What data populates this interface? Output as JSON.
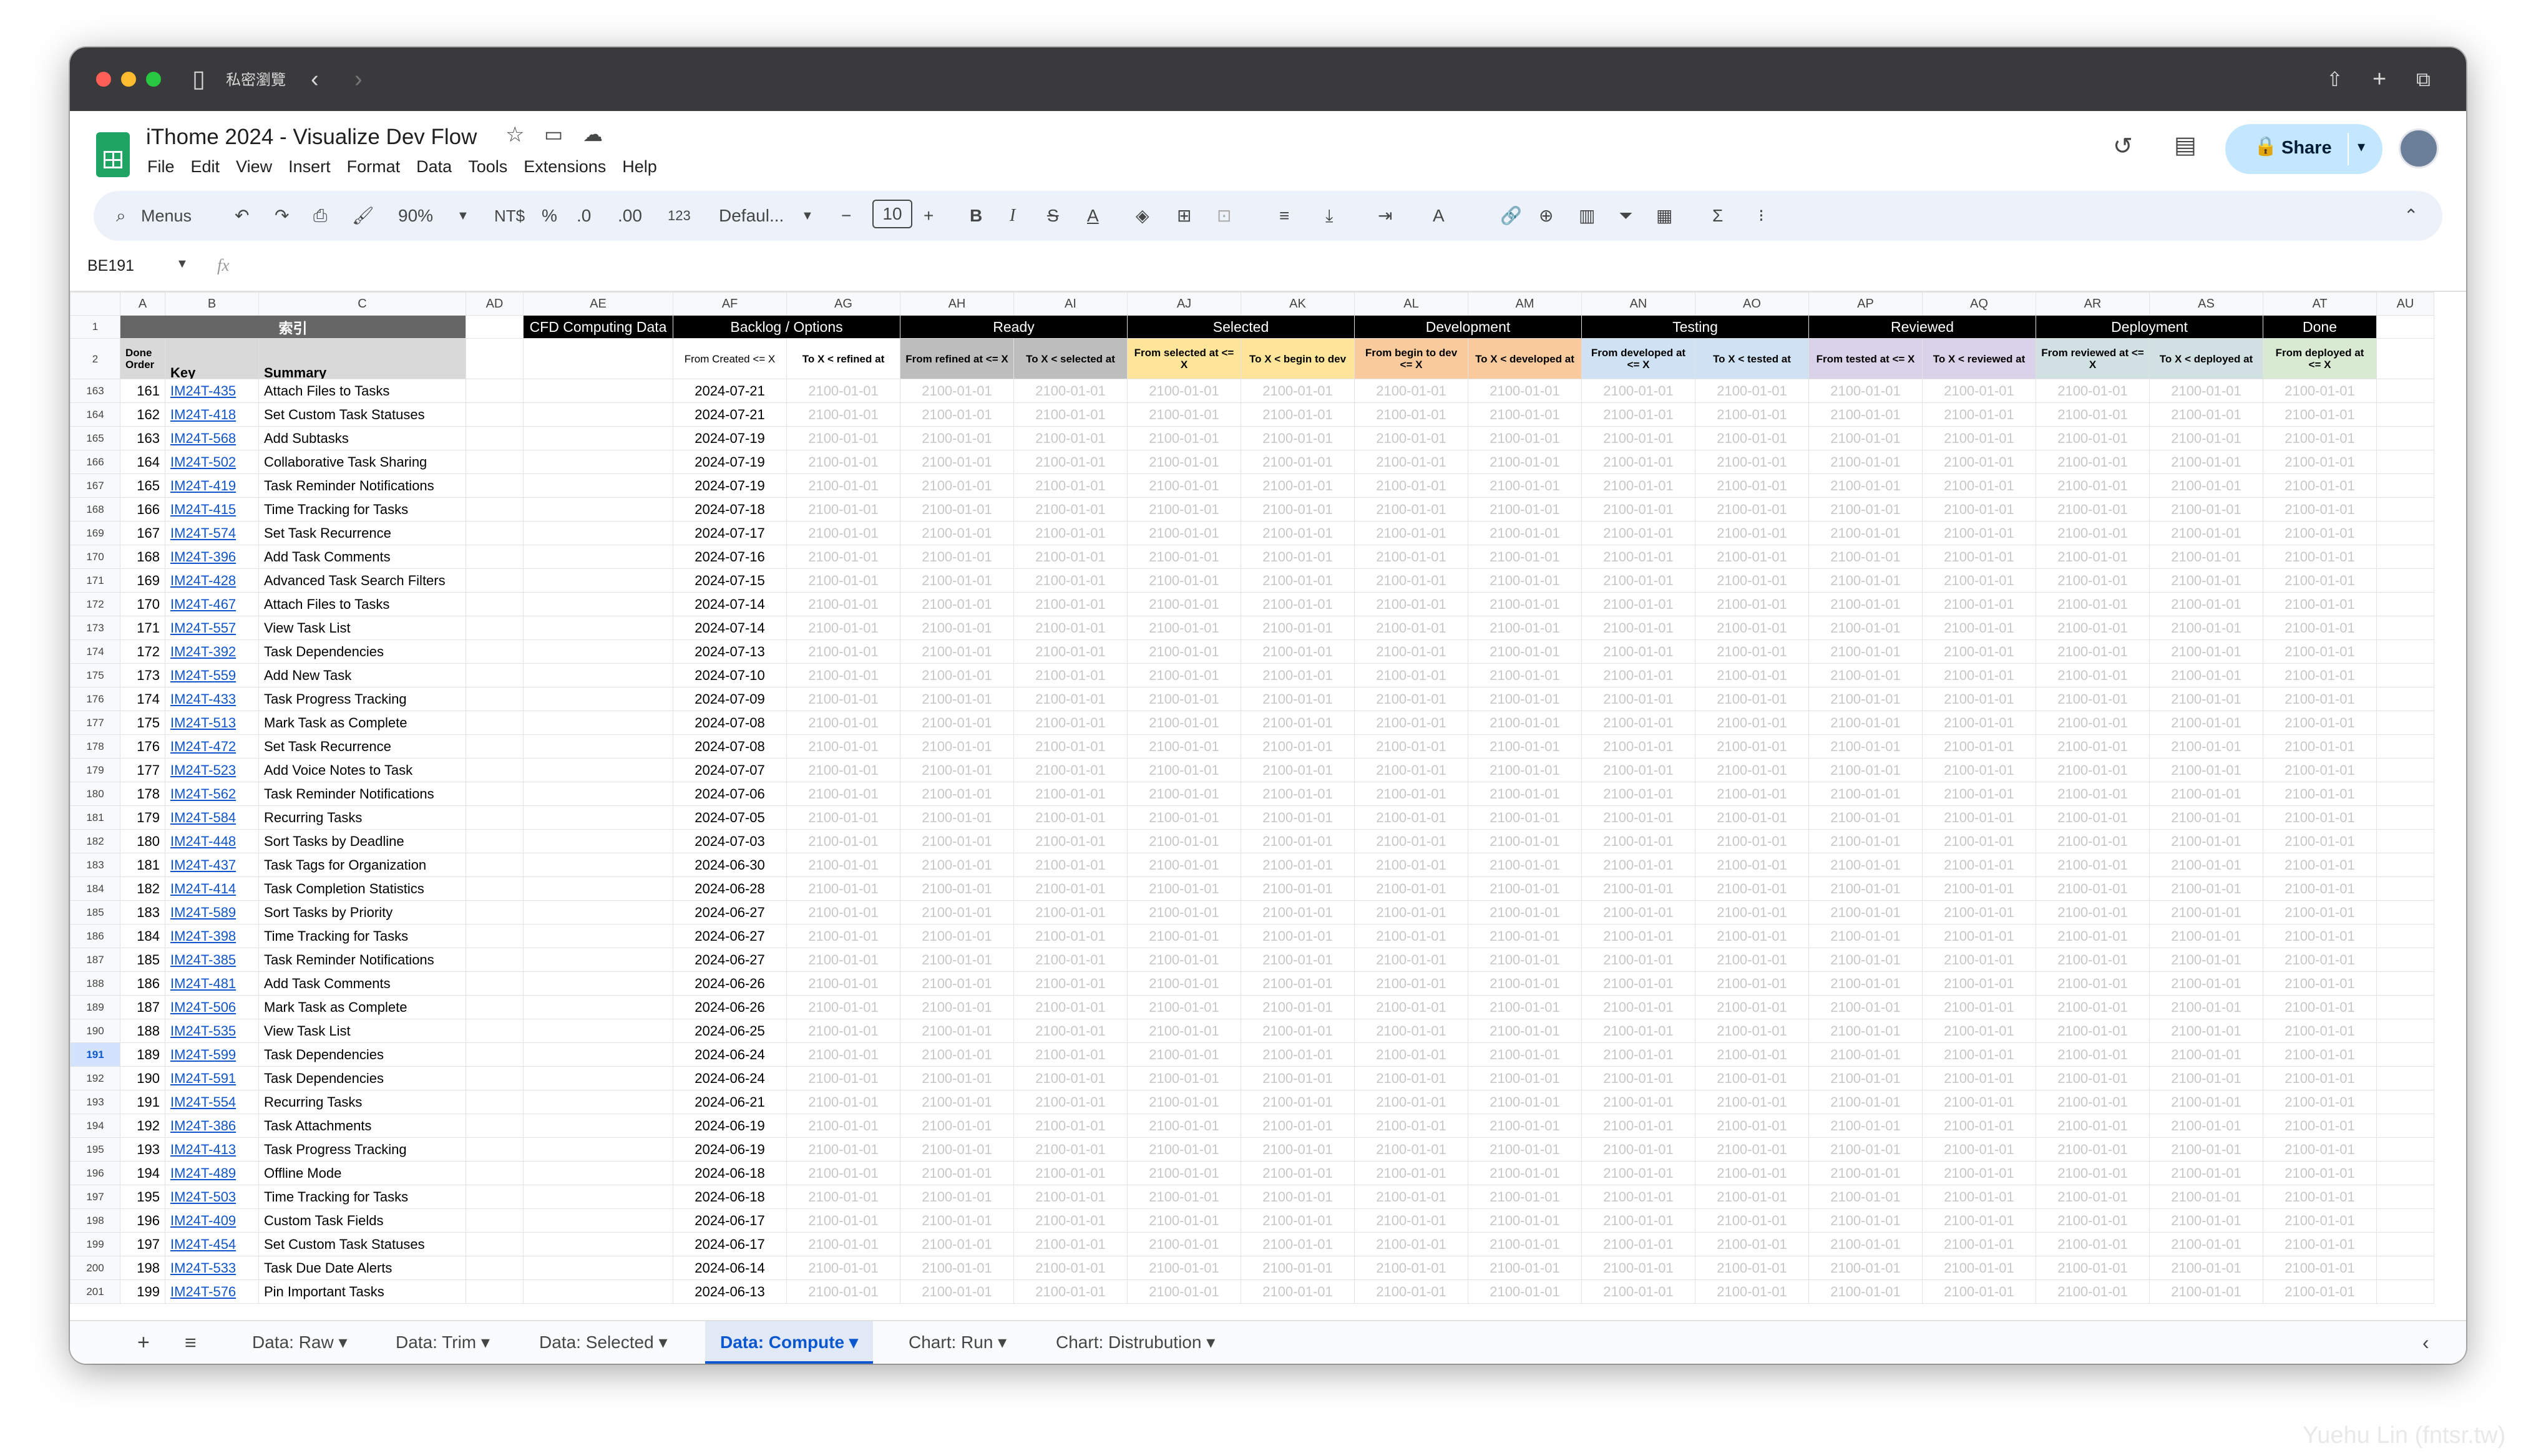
{
  "browser": {
    "private_label": "私密瀏覽",
    "back_icon": "chevron-left-icon",
    "forward_icon": "chevron-right-icon"
  },
  "doc": {
    "title": "iThome 2024 - Visualize Dev Flow"
  },
  "menu": [
    "File",
    "Edit",
    "View",
    "Insert",
    "Format",
    "Data",
    "Tools",
    "Extensions",
    "Help"
  ],
  "share_label": "Share",
  "toolbar": {
    "search": "Menus",
    "zoom": "90%",
    "currency": "NT$",
    "percent": "%",
    "dec_dec": ".0",
    "inc_dec": ".00",
    "num_fmt": "123",
    "font": "Defaul...",
    "font_size": "10"
  },
  "namebox": "BE191",
  "fx": "fx",
  "columns": [
    "A",
    "B",
    "C",
    "AD",
    "AE",
    "AF",
    "AG",
    "AH",
    "AI",
    "AJ",
    "AK",
    "AL",
    "AM",
    "AN",
    "AO",
    "AP",
    "AQ",
    "AR",
    "AS",
    "AT",
    "AU"
  ],
  "header1": {
    "index": "索引",
    "cfd": "CFD Computing Data",
    "backlog": "Backlog / Options",
    "ready": "Ready",
    "selected": "Selected",
    "development": "Development",
    "testing": "Testing",
    "reviewed": "Reviewed",
    "deployment": "Deployment",
    "done": "Done"
  },
  "header2": {
    "done_order": "Done Order",
    "key": "Key",
    "summary": "Summary",
    "af": "From Created <= X",
    "ag": "To X < refined at",
    "ah": "From refined at <= X",
    "ai": "To X < selected at",
    "aj": "From selected at <= X",
    "ak": "To X < begin to dev",
    "al": "From begin to dev <= X",
    "am": "To X < developed at",
    "an": "From developed at <= X",
    "ao": "To X < tested at",
    "ap": "From tested at <= X",
    "aq": "To X < reviewed at",
    "ar": "From reviewed at <= X",
    "as": "To X < deployed at",
    "at": "From deployed at <= X"
  },
  "colors": {
    "ready": "#bdbdbd",
    "selected": "#ffe599",
    "development": "#f9cb9c",
    "testing": "#cfe2f3",
    "reviewed": "#d9d2e9",
    "deployment": "#d0e0e3",
    "done": "#d9ead3"
  },
  "placeholder_date": "2100-01-01",
  "rows": [
    {
      "r": "163",
      "n": "161",
      "key": "IM24T-435",
      "sum": "Attach Files to Tasks",
      "date": "2024-07-21"
    },
    {
      "r": "164",
      "n": "162",
      "key": "IM24T-418",
      "sum": "Set Custom Task Statuses",
      "date": "2024-07-21"
    },
    {
      "r": "165",
      "n": "163",
      "key": "IM24T-568",
      "sum": "Add Subtasks",
      "date": "2024-07-19"
    },
    {
      "r": "166",
      "n": "164",
      "key": "IM24T-502",
      "sum": "Collaborative Task Sharing",
      "date": "2024-07-19"
    },
    {
      "r": "167",
      "n": "165",
      "key": "IM24T-419",
      "sum": "Task Reminder Notifications",
      "date": "2024-07-19"
    },
    {
      "r": "168",
      "n": "166",
      "key": "IM24T-415",
      "sum": "Time Tracking for Tasks",
      "date": "2024-07-18"
    },
    {
      "r": "169",
      "n": "167",
      "key": "IM24T-574",
      "sum": "Set Task Recurrence",
      "date": "2024-07-17"
    },
    {
      "r": "170",
      "n": "168",
      "key": "IM24T-396",
      "sum": "Add Task Comments",
      "date": "2024-07-16"
    },
    {
      "r": "171",
      "n": "169",
      "key": "IM24T-428",
      "sum": "Advanced Task Search Filters",
      "date": "2024-07-15"
    },
    {
      "r": "172",
      "n": "170",
      "key": "IM24T-467",
      "sum": "Attach Files to Tasks",
      "date": "2024-07-14"
    },
    {
      "r": "173",
      "n": "171",
      "key": "IM24T-557",
      "sum": "View Task List",
      "date": "2024-07-14"
    },
    {
      "r": "174",
      "n": "172",
      "key": "IM24T-392",
      "sum": "Task Dependencies",
      "date": "2024-07-13"
    },
    {
      "r": "175",
      "n": "173",
      "key": "IM24T-559",
      "sum": "Add New Task",
      "date": "2024-07-10"
    },
    {
      "r": "176",
      "n": "174",
      "key": "IM24T-433",
      "sum": "Task Progress Tracking",
      "date": "2024-07-09"
    },
    {
      "r": "177",
      "n": "175",
      "key": "IM24T-513",
      "sum": "Mark Task as Complete",
      "date": "2024-07-08"
    },
    {
      "r": "178",
      "n": "176",
      "key": "IM24T-472",
      "sum": "Set Task Recurrence",
      "date": "2024-07-08"
    },
    {
      "r": "179",
      "n": "177",
      "key": "IM24T-523",
      "sum": "Add Voice Notes to Task",
      "date": "2024-07-07"
    },
    {
      "r": "180",
      "n": "178",
      "key": "IM24T-562",
      "sum": "Task Reminder Notifications",
      "date": "2024-07-06"
    },
    {
      "r": "181",
      "n": "179",
      "key": "IM24T-584",
      "sum": "Recurring Tasks",
      "date": "2024-07-05"
    },
    {
      "r": "182",
      "n": "180",
      "key": "IM24T-448",
      "sum": "Sort Tasks by Deadline",
      "date": "2024-07-03"
    },
    {
      "r": "183",
      "n": "181",
      "key": "IM24T-437",
      "sum": "Task Tags for Organization",
      "date": "2024-06-30"
    },
    {
      "r": "184",
      "n": "182",
      "key": "IM24T-414",
      "sum": "Task Completion Statistics",
      "date": "2024-06-28"
    },
    {
      "r": "185",
      "n": "183",
      "key": "IM24T-589",
      "sum": "Sort Tasks by Priority",
      "date": "2024-06-27"
    },
    {
      "r": "186",
      "n": "184",
      "key": "IM24T-398",
      "sum": "Time Tracking for Tasks",
      "date": "2024-06-27"
    },
    {
      "r": "187",
      "n": "185",
      "key": "IM24T-385",
      "sum": "Task Reminder Notifications",
      "date": "2024-06-27"
    },
    {
      "r": "188",
      "n": "186",
      "key": "IM24T-481",
      "sum": "Add Task Comments",
      "date": "2024-06-26"
    },
    {
      "r": "189",
      "n": "187",
      "key": "IM24T-506",
      "sum": "Mark Task as Complete",
      "date": "2024-06-26"
    },
    {
      "r": "190",
      "n": "188",
      "key": "IM24T-535",
      "sum": "View Task List",
      "date": "2024-06-25"
    },
    {
      "r": "191",
      "n": "189",
      "key": "IM24T-599",
      "sum": "Task Dependencies",
      "date": "2024-06-24"
    },
    {
      "r": "192",
      "n": "190",
      "key": "IM24T-591",
      "sum": "Task Dependencies",
      "date": "2024-06-24"
    },
    {
      "r": "193",
      "n": "191",
      "key": "IM24T-554",
      "sum": "Recurring Tasks",
      "date": "2024-06-21"
    },
    {
      "r": "194",
      "n": "192",
      "key": "IM24T-386",
      "sum": "Task Attachments",
      "date": "2024-06-19"
    },
    {
      "r": "195",
      "n": "193",
      "key": "IM24T-413",
      "sum": "Task Progress Tracking",
      "date": "2024-06-19"
    },
    {
      "r": "196",
      "n": "194",
      "key": "IM24T-489",
      "sum": "Offline Mode",
      "date": "2024-06-18"
    },
    {
      "r": "197",
      "n": "195",
      "key": "IM24T-503",
      "sum": "Time Tracking for Tasks",
      "date": "2024-06-18"
    },
    {
      "r": "198",
      "n": "196",
      "key": "IM24T-409",
      "sum": "Custom Task Fields",
      "date": "2024-06-17"
    },
    {
      "r": "199",
      "n": "197",
      "key": "IM24T-454",
      "sum": "Set Custom Task Statuses",
      "date": "2024-06-17"
    },
    {
      "r": "200",
      "n": "198",
      "key": "IM24T-533",
      "sum": "Task Due Date Alerts",
      "date": "2024-06-14"
    },
    {
      "r": "201",
      "n": "199",
      "key": "IM24T-576",
      "sum": "Pin Important Tasks",
      "date": "2024-06-13"
    }
  ],
  "sheet_tabs": [
    "Data: Raw",
    "Data: Trim",
    "Data: Selected",
    "Data: Compute",
    "Chart: Run",
    "Chart: Distrubution"
  ],
  "active_tab": "Data: Compute",
  "watermark": "Yuehu Lin (fntsr.tw)"
}
